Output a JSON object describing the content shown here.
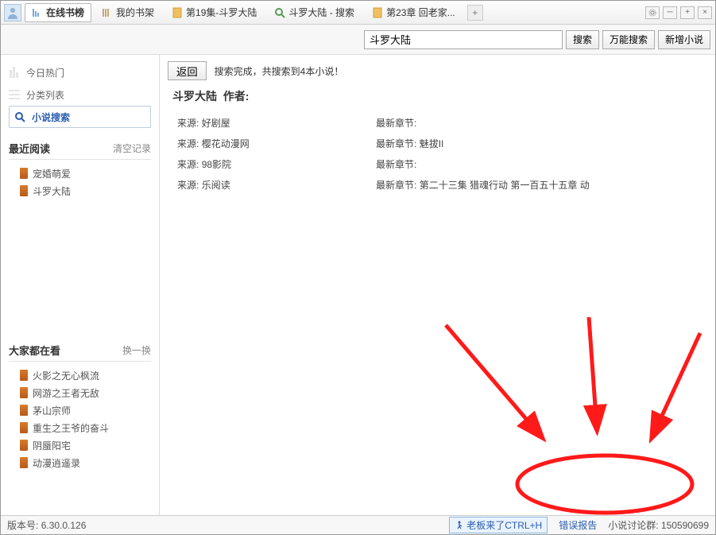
{
  "topbar": {
    "tabs": [
      {
        "label": "在线书榜",
        "active": true
      },
      {
        "label": "我的书架"
      },
      {
        "label": "第19集-斗罗大陆"
      },
      {
        "label": "斗罗大陆 - 搜索"
      },
      {
        "label": "第23章 回老家..."
      }
    ]
  },
  "search": {
    "value": "斗罗大陆",
    "btn_search": "搜索",
    "btn_universal": "万能搜索",
    "btn_add": "新增小说"
  },
  "sidebar": {
    "nav": {
      "hot": "今日热门",
      "category": "分类列表",
      "search": "小说搜索"
    },
    "recent": {
      "title": "最近阅读",
      "clear": "清空记录",
      "items": [
        "宠婚萌爱",
        "斗罗大陆"
      ]
    },
    "popular": {
      "title": "大家都在看",
      "swap": "换一换",
      "items": [
        "火影之无心枫流",
        "网游之王者无敌",
        "茅山宗师",
        "重生之王爷的奋斗",
        "阴蜃阳宅",
        "动漫逍遥录"
      ]
    }
  },
  "content": {
    "back": "返回",
    "summary": "搜索完成，共搜索到4本小说！",
    "book_title": "斗罗大陆",
    "author_label": "作者:",
    "source_label": "来源:",
    "chapter_label": "最新章节:",
    "rows": [
      {
        "source": "好剧屋",
        "chapter": ""
      },
      {
        "source": "樱花动漫网",
        "chapter": "魅拔II"
      },
      {
        "source": "98影院",
        "chapter": ""
      },
      {
        "source": "乐阅读",
        "chapter": "第二十三集 猎魂行动 第一百五十五章 动"
      }
    ]
  },
  "statusbar": {
    "version_label": "版本号:",
    "version": "6.30.0.126",
    "boss": "老板来了CTRL+H",
    "bug_report": "错误报告",
    "qq_label": "小说讨论群:",
    "qq": "150590699"
  }
}
